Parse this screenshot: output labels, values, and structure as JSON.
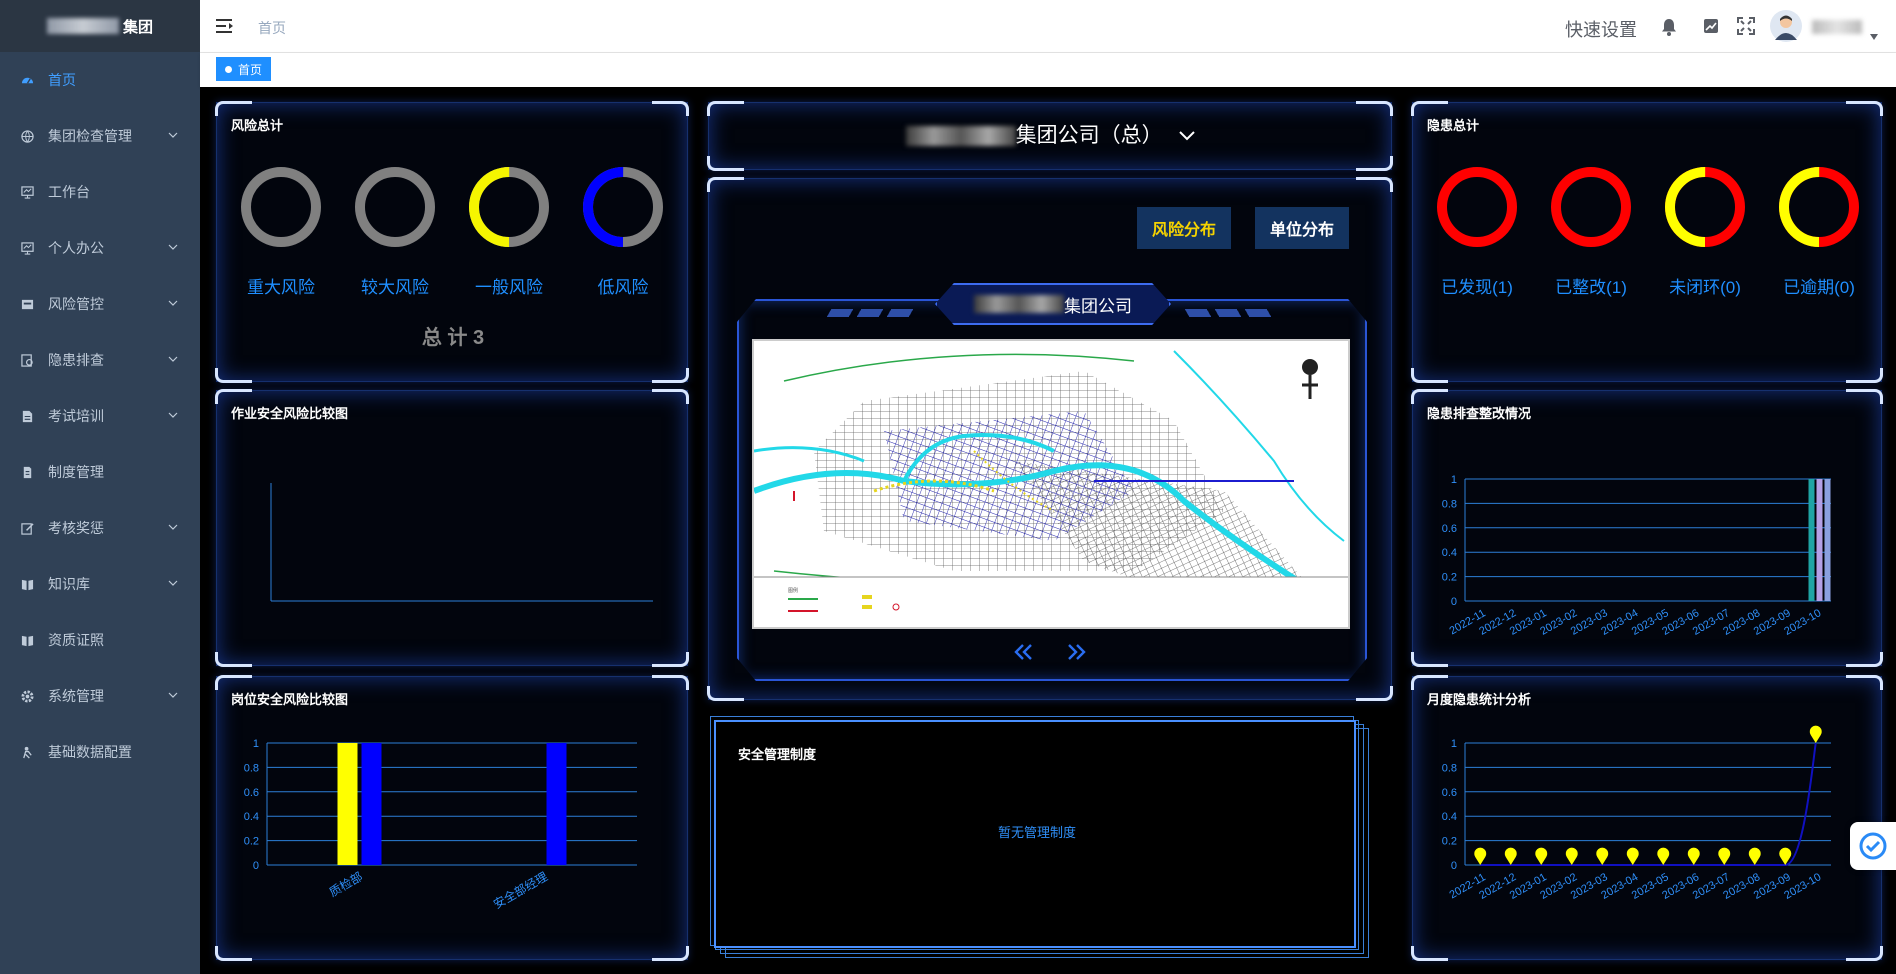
{
  "sidebar": {
    "logo_suffix": "集团",
    "items": [
      {
        "label": "首页",
        "icon": "dashboard-icon",
        "active": true,
        "has_children": false
      },
      {
        "label": "集团检查管理",
        "icon": "globe-icon",
        "active": false,
        "has_children": true
      },
      {
        "label": "工作台",
        "icon": "monitor-icon",
        "active": false,
        "has_children": false
      },
      {
        "label": "个人办公",
        "icon": "monitor-icon",
        "active": false,
        "has_children": true
      },
      {
        "label": "风险管控",
        "icon": "alert-box-icon",
        "active": false,
        "has_children": true
      },
      {
        "label": "隐患排查",
        "icon": "eye-search-icon",
        "active": false,
        "has_children": true
      },
      {
        "label": "考试培训",
        "icon": "document-icon",
        "active": false,
        "has_children": true
      },
      {
        "label": "制度管理",
        "icon": "file-icon",
        "active": false,
        "has_children": false
      },
      {
        "label": "考核奖惩",
        "icon": "edit-icon",
        "active": false,
        "has_children": true
      },
      {
        "label": "知识库",
        "icon": "book-icon",
        "active": false,
        "has_children": true
      },
      {
        "label": "资质证照",
        "icon": "book-icon",
        "active": false,
        "has_children": false
      },
      {
        "label": "系统管理",
        "icon": "gear-icon",
        "active": false,
        "has_children": true
      },
      {
        "label": "基础数据配置",
        "icon": "person-icon",
        "active": false,
        "has_children": false
      }
    ]
  },
  "topbar": {
    "breadcrumb": "首页",
    "quick_settings": "快速设置"
  },
  "tags": {
    "home": "首页"
  },
  "header": {
    "company_suffix": "集团公司（总）"
  },
  "risk_total": {
    "title": "风险总计",
    "total_label": "总 计 3",
    "rings": [
      {
        "label": "重大风险",
        "fraction": 0,
        "color": "#808080",
        "track": "#808080"
      },
      {
        "label": "较大风险",
        "fraction": 0,
        "color": "#808080",
        "track": "#808080"
      },
      {
        "label": "一般风险",
        "fraction": 0.5,
        "color": "#f5f500",
        "track": "#808080"
      },
      {
        "label": "低风险",
        "fraction": 0.5,
        "color": "#0000ff",
        "track": "#808080"
      }
    ]
  },
  "job_risk_chart": {
    "title": "作业安全风险比较图"
  },
  "post_risk_chart": {
    "title": "岗位安全风险比较图"
  },
  "map_panel": {
    "buttons": [
      "风险分布",
      "单位分布"
    ],
    "active_button": "风险分布",
    "company_suffix": "集团公司"
  },
  "policy_panel": {
    "title": "安全管理制度",
    "empty_text": "暂无管理制度"
  },
  "hazard_total": {
    "title": "隐患总计",
    "rings": [
      {
        "label": "已发现(1)",
        "fraction": 0,
        "color": "#ff0000",
        "track": "#ff0000"
      },
      {
        "label": "已整改(1)",
        "fraction": 0,
        "color": "#ff0000",
        "track": "#ff0000"
      },
      {
        "label": "未闭环(0)",
        "fraction": 0.5,
        "color": "#ffff00",
        "track": "#ff0000"
      },
      {
        "label": "已逾期(0)",
        "fraction": 0.5,
        "color": "#ffff00",
        "track": "#ff0000"
      }
    ]
  },
  "hazard_rectify": {
    "title": "隐患排查整改情况"
  },
  "monthly_hazard": {
    "title": "月度隐患统计分析"
  },
  "chart_data": [
    {
      "type": "bar",
      "title": "岗位安全风险比较图",
      "categories": [
        "质检部",
        "安全部经理"
      ],
      "series": [
        {
          "values": [
            1,
            0
          ],
          "color": "#ffff00"
        },
        {
          "values": [
            1,
            1
          ],
          "color": "#0000ff"
        }
      ],
      "ylim": [
        0,
        1
      ],
      "yticks": [
        "0",
        "0.2",
        "0.4",
        "0.6",
        "0.8",
        "1"
      ],
      "grid": true
    },
    {
      "type": "bar",
      "title": "隐患排查整改情况",
      "categories": [
        "2022-11",
        "2022-12",
        "2023-01",
        "2023-02",
        "2023-03",
        "2023-04",
        "2023-05",
        "2023-06",
        "2023-07",
        "2023-08",
        "2023-09",
        "2023-10"
      ],
      "series": [
        {
          "values": [
            0,
            0,
            0,
            0,
            0,
            0,
            0,
            0,
            0,
            0,
            0,
            1
          ],
          "color": "#1fa5a5"
        },
        {
          "values": [
            0,
            0,
            0,
            0,
            0,
            0,
            0,
            0,
            0,
            0,
            0,
            1
          ],
          "color": "#b4a0e6"
        },
        {
          "values": [
            0,
            0,
            0,
            0,
            0,
            0,
            0,
            0,
            0,
            0,
            0,
            1
          ],
          "color": "#8aa0e0"
        }
      ],
      "ylim": [
        0,
        1
      ],
      "yticks": [
        "0",
        "0.2",
        "0.4",
        "0.6",
        "0.8",
        "1"
      ],
      "grid": true
    },
    {
      "type": "line",
      "title": "月度隐患统计分析",
      "categories": [
        "2022-11",
        "2022-12",
        "2023-01",
        "2023-02",
        "2023-03",
        "2023-04",
        "2023-05",
        "2023-06",
        "2023-07",
        "2023-08",
        "2023-09",
        "2023-10"
      ],
      "series": [
        {
          "values": [
            0,
            0,
            0,
            0,
            0,
            0,
            0,
            0,
            0,
            0,
            0,
            1
          ],
          "color": "#1010c0",
          "marker_color": "#ffff00"
        }
      ],
      "ylim": [
        0,
        1
      ],
      "yticks": [
        "0",
        "0.2",
        "0.4",
        "0.6",
        "0.8",
        "1"
      ],
      "grid": true
    }
  ]
}
